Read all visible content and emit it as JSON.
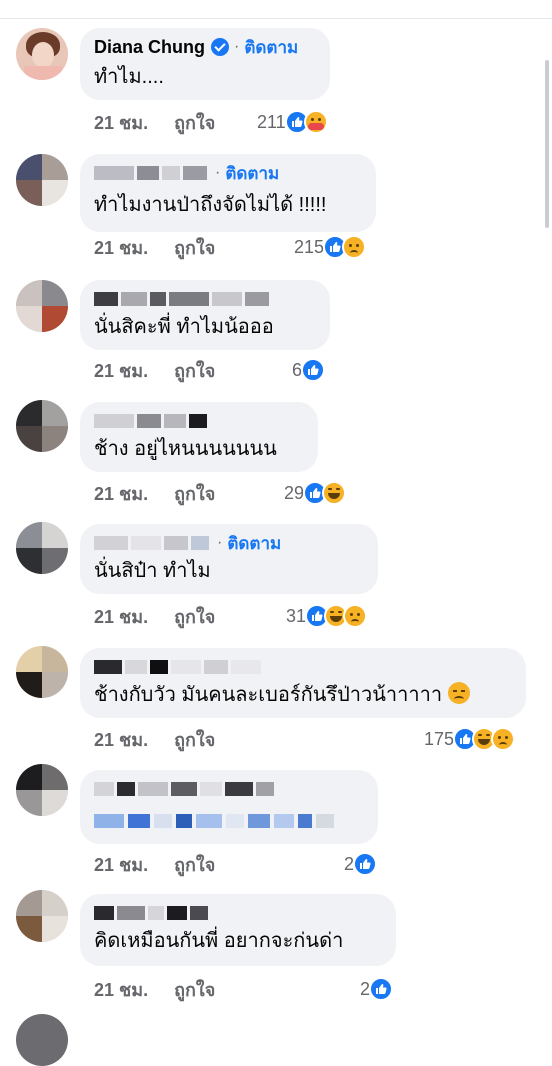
{
  "comments": [
    {
      "name": "Diana Chung",
      "verified": true,
      "follow": "ติดตาม",
      "text": "ทำไม....",
      "time": "21 ชม.",
      "like": "ถูกใจ",
      "count": "211",
      "reactions": [
        "like-icon",
        "care-icon"
      ]
    },
    {
      "name": "",
      "verified": false,
      "follow": "ติดตาม",
      "text": "ทำไมงานป่าถึงจัดไม่ได้ !!!!!",
      "time": "21 ชม.",
      "like": "ถูกใจ",
      "count": "215",
      "reactions": [
        "like-icon",
        "sad-icon"
      ]
    },
    {
      "name": "",
      "verified": false,
      "follow": "",
      "text": "นั่นสิคะพี่ ทำไมน้อออ",
      "time": "21 ชม.",
      "like": "ถูกใจ",
      "count": "6",
      "reactions": [
        "like-icon"
      ]
    },
    {
      "name": "",
      "verified": false,
      "follow": "",
      "text": "ช้าง อยู่ไหนนนนนนน",
      "time": "21 ชม.",
      "like": "ถูกใจ",
      "count": "29",
      "reactions": [
        "like-icon",
        "haha-icon"
      ]
    },
    {
      "name": "",
      "verified": false,
      "follow": "ติดตาม",
      "text": "นั่นสิป๋า ทำไม",
      "time": "21 ชม.",
      "like": "ถูกใจ",
      "count": "31",
      "reactions": [
        "like-icon",
        "haha-icon",
        "sad-icon"
      ]
    },
    {
      "name": "",
      "verified": false,
      "follow": "",
      "text": "ช้างกับวัว มันคนละเบอร์กันรึป่าวน้าาาาา",
      "time": "21 ชม.",
      "like": "ถูกใจ",
      "count": "175",
      "reactions": [
        "like-icon",
        "haha-icon",
        "sad-icon"
      ]
    },
    {
      "name": "",
      "verified": false,
      "follow": "",
      "text": "",
      "time": "21 ชม.",
      "like": "ถูกใจ",
      "count": "2",
      "reactions": [
        "like-icon"
      ]
    },
    {
      "name": "",
      "verified": false,
      "follow": "",
      "text": "คิดเหมือนกันพี่ อยากจะก่นด่า",
      "time": "21 ชม.",
      "like": "ถูกใจ",
      "count": "2",
      "reactions": [
        "like-icon"
      ]
    }
  ],
  "colors": {
    "accent": "#1877f2",
    "bubble": "#f0f2f5",
    "meta": "#65676b"
  }
}
